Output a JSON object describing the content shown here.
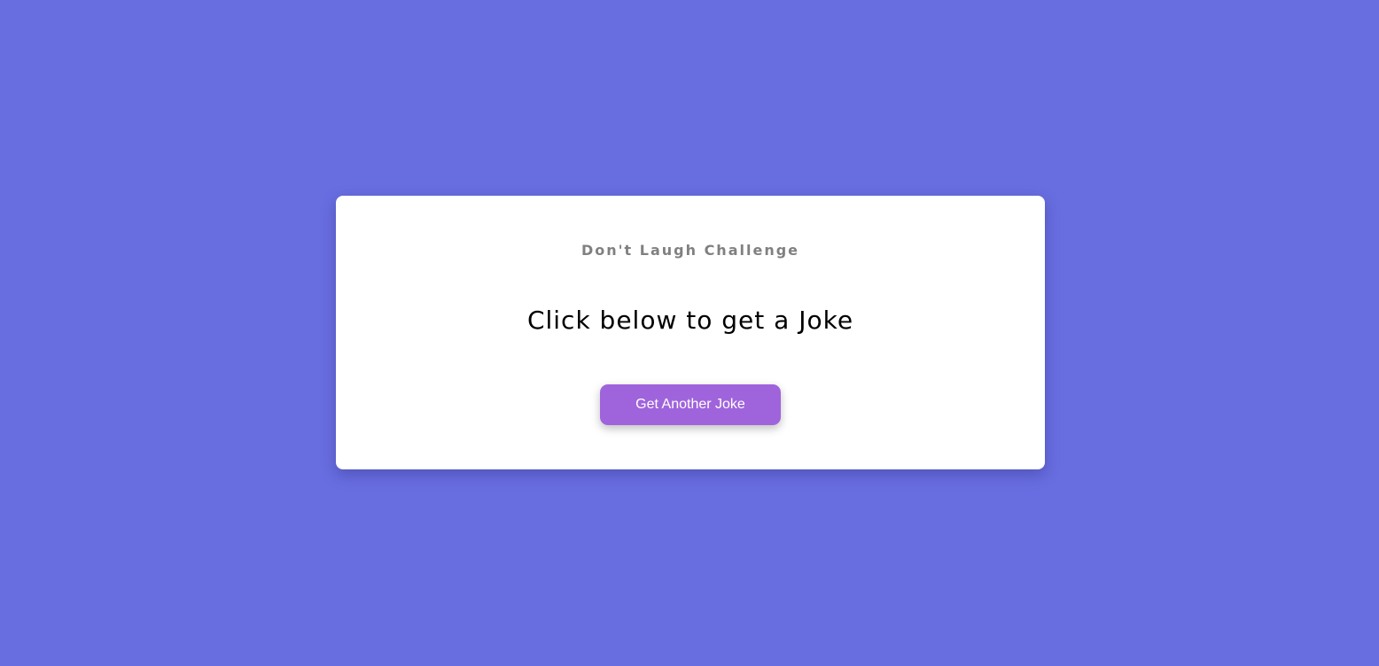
{
  "card": {
    "heading": "Don't Laugh Challenge",
    "joke_text": "Click below to get a Joke",
    "button_label": "Get Another Joke"
  },
  "colors": {
    "background": "#686de0",
    "button": "#9f64dc"
  }
}
